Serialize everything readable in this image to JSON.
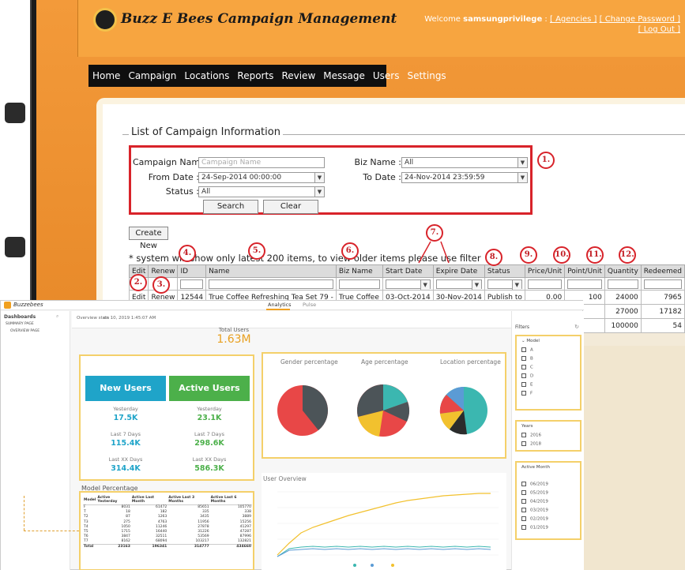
{
  "campaign": {
    "app_title": "Buzz E Bees Campaign Management",
    "welcome_prefix": "Welcome",
    "username": "samsungprivilege",
    "links": {
      "agencies": "[ Agencies ]",
      "change_password": "[ Change Password ]",
      "logout": "[ Log Out ]"
    },
    "nav": [
      "Home",
      "Campaign",
      "Locations",
      "Reports",
      "Review",
      "Message",
      "Users",
      "Settings"
    ],
    "list_title": "List of Campaign Information",
    "filter": {
      "campaign_name_label": "Campaign Name :",
      "campaign_name_placeholder": "Campaign Name",
      "biz_name_label": "Biz Name :",
      "biz_name_value": "All",
      "from_date_label": "From Date :",
      "from_date_value": "24-Sep-2014 00:00:00",
      "to_date_label": "To Date :",
      "to_date_value": "24-Nov-2014 23:59:59",
      "status_label": "Status :",
      "status_value": "All",
      "search_label": "Search",
      "clear_label": "Clear"
    },
    "create_new_label": "Create New",
    "note": "* system will show only latest 200 items, to view older items please use filter",
    "columns": [
      "Edit",
      "Renew",
      "ID",
      "Name",
      "Biz Name",
      "Start Date",
      "Expire Date",
      "Status",
      "Price/Unit",
      "Point/Unit",
      "Quantity",
      "Redeemed"
    ],
    "rows": [
      {
        "edit": "Edit",
        "renew": "Renew",
        "id": "12544",
        "name": "True Coffee Refreshing Tea Set 79 -",
        "biz": "True Coffee",
        "start": "03-Oct-2014",
        "expire": "30-Nov-2014",
        "status": "Publish to",
        "price": "0.00",
        "point": "100",
        "quantity": "24000",
        "redeemed": "7965"
      },
      {
        "edit": "",
        "renew": "",
        "id": "",
        "name": "",
        "biz": "",
        "start": "",
        "expire": "",
        "status": "",
        "price": "",
        "point": "",
        "quantity": "27000",
        "redeemed": "17182"
      },
      {
        "edit": "",
        "renew": "",
        "id": "",
        "name": "",
        "biz": "",
        "start": "",
        "expire": "",
        "status": "",
        "price": "",
        "point": "",
        "quantity": "100000",
        "redeemed": "54"
      }
    ],
    "markers": [
      "1.",
      "2.",
      "3.",
      "4.",
      "5.",
      "6.",
      "7.",
      "8.",
      "9.",
      "10.",
      "11.",
      "12."
    ]
  },
  "dashboard": {
    "brand": "Buzzebees",
    "tabs": {
      "analytics": "Analytics",
      "pulse": "Pulse"
    },
    "sidebar": {
      "header": "Dashboards",
      "item1": "SUMMARY PAGE",
      "item2": "OVERVIEW PAGE"
    },
    "subheader": {
      "crumb": "Overview stats",
      "date": "on 10, 2019 1:45:07 AM"
    },
    "total_users_label": "Total Users",
    "total_users_value": "1.63M",
    "new_users": {
      "title": "New Users",
      "yesterday_label": "Yesterday",
      "yesterday": "17.5K",
      "last7_label": "Last 7 Days",
      "last7": "115.4K",
      "lastxx_label": "Last XX Days",
      "lastxx": "314.4K"
    },
    "active_users": {
      "title": "Active Users",
      "yesterday_label": "Yesterday",
      "yesterday": "23.1K",
      "last7_label": "Last 7 Days",
      "last7": "298.6K",
      "lastxx_label": "Last XX Days",
      "lastxx": "586.3K"
    },
    "model_percentage_title": "Model Percentage",
    "model_table": {
      "headers": [
        "Model",
        "Active Yesterday",
        "Active Last Month",
        "Active Last 3 Months",
        "Active Last 6 Months"
      ],
      "rows": [
        [
          "F",
          "8031",
          "61472",
          "85651",
          "105770"
        ],
        [
          "T",
          "18",
          "182",
          "335",
          "338"
        ],
        [
          "T2",
          "87",
          "1263",
          "3435",
          "3889"
        ],
        [
          "T3",
          "275",
          "4763",
          "11956",
          "15256"
        ],
        [
          "T4",
          "1050",
          "11246",
          "27878",
          "41297"
        ],
        [
          "T5",
          "1715",
          "16440",
          "31226",
          "47287"
        ],
        [
          "T6",
          "3847",
          "32511",
          "53569",
          "87996"
        ],
        [
          "T7",
          "8162",
          "68094",
          "103217",
          "132821"
        ],
        [
          "Total",
          "23163",
          "196341",
          "314777",
          "434660"
        ]
      ]
    },
    "pies": {
      "gender": "Gender percentage",
      "age": "Age percentage",
      "location": "Location percentage"
    },
    "user_overview_title": "User Overview",
    "filters": {
      "title": "Filters",
      "model_header": "Model",
      "models": [
        "A",
        "B",
        "C",
        "D",
        "E",
        "F"
      ],
      "years_header": "Years",
      "years": [
        "2016",
        "2018"
      ],
      "active_month_header": "Active Month",
      "months": [
        "06/2019",
        "05/2019",
        "04/2019",
        "03/2019",
        "02/2019",
        "01/2019"
      ]
    },
    "colors": {
      "new_users": "#1fa4c9",
      "active_users": "#4cb04a",
      "accent": "#e8a020",
      "highlight": "#f4d06a"
    }
  }
}
